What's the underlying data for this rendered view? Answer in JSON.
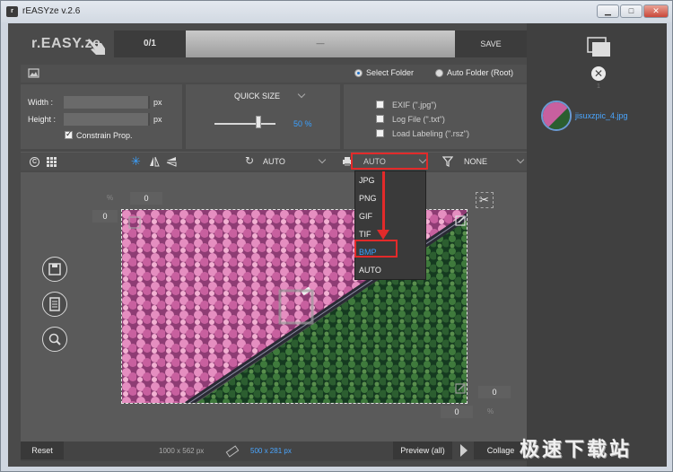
{
  "window": {
    "title": "rEASYze v.2.6",
    "icon_letter": "r"
  },
  "toolbar": {
    "logo": "r.EASY.ze",
    "counter": "0/1",
    "progress_text": "—",
    "save_label": "SAVE"
  },
  "folder": {
    "select_folder": "Select Folder",
    "auto_folder": "Auto Folder (Root)",
    "selected": "Select Folder"
  },
  "size": {
    "width_label": "Width :",
    "height_label": "Height :",
    "width_value": "",
    "height_value": "",
    "unit": "px",
    "constrain_label": "Constrain Prop.",
    "constrain_checked": true
  },
  "quick_size": {
    "label": "QUICK SIZE",
    "percent": "50 %",
    "slider_value": 0.5
  },
  "metadata": {
    "exif": {
      "label": "EXIF (\".jpg\")",
      "checked": false
    },
    "log": {
      "label": "Log File (\".txt\")",
      "checked": false
    },
    "labeling": {
      "label": "Load Labeling (\".rsz\")",
      "checked": false
    }
  },
  "tools": {
    "rotate_value": "AUTO",
    "format_value": "AUTO",
    "filter_value": "NONE"
  },
  "format_menu": {
    "items": [
      "JPG",
      "PNG",
      "GIF",
      "TIF",
      "BMP",
      "AUTO"
    ],
    "highlighted": "BMP"
  },
  "canvas": {
    "top_pct": "%",
    "top_value": "0",
    "left_value": "0",
    "right_value": "0",
    "bottom_value": "0",
    "bottom_pct": "%",
    "photo_watermark": "draw"
  },
  "bottom": {
    "reset_label": "Reset",
    "original_size": "1000 x 562 px",
    "new_size": "500 x 281 px",
    "preview_label": "Preview (all)",
    "collage_label": "Collage"
  },
  "files": {
    "count": "1",
    "items": [
      {
        "name": "jisuxzpic_4.jpg"
      }
    ]
  },
  "watermark": {
    "text": "极速下载站"
  },
  "colors": {
    "accent": "#3aa0ff",
    "highlight_red": "#e22a2a",
    "panel_bg": "#4a4a4a"
  }
}
